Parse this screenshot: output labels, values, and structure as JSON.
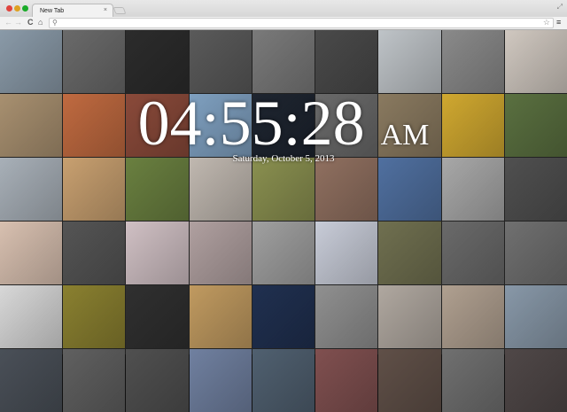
{
  "browser": {
    "tab_title": "New Tab",
    "tab_close": "×",
    "back": "←",
    "forward": "→",
    "reload": "C",
    "home": "⌂",
    "search_glyph": "⚲",
    "star": "☆",
    "menu": "≡",
    "fullscreen": "⤢"
  },
  "clock": {
    "time": "04:55:28",
    "ampm": "AM",
    "date": "Saturday, October 5, 2013"
  },
  "tiles": [
    "#8a9aa8",
    "#6a6a6a",
    "#2c2c2c",
    "#5a5a5a",
    "#7a7a7a",
    "#4a4a4a",
    "#bfc4c8",
    "#8a8a8a",
    "#d0c8c0",
    "#a89070",
    "#c06a40",
    "#8a4a3a",
    "#7fa0c0",
    "#1e2530",
    "#6a6a6a",
    "#8a7a60",
    "#d0a830",
    "#5a7040",
    "#a8b0b8",
    "#c8a070",
    "#6a8040",
    "#c0b8b0",
    "#8a9050",
    "#907060",
    "#5070a0",
    "#a8a8a8",
    "#505050",
    "#d8c0b0",
    "#555555",
    "#d0c0c4",
    "#b0a0a0",
    "#a0a0a0",
    "#c8ccd8",
    "#707050",
    "#6a6a6a",
    "#707070",
    "#d8d8d8",
    "#8a8030",
    "#303030",
    "#c09a60",
    "#203050",
    "#909090",
    "#b0a8a0",
    "#b0a090",
    "#8898a8",
    "#4a5058",
    "#606060",
    "#505050",
    "#7080a0",
    "#506070",
    "#805050",
    "#605048",
    "#707070",
    "#504848"
  ]
}
